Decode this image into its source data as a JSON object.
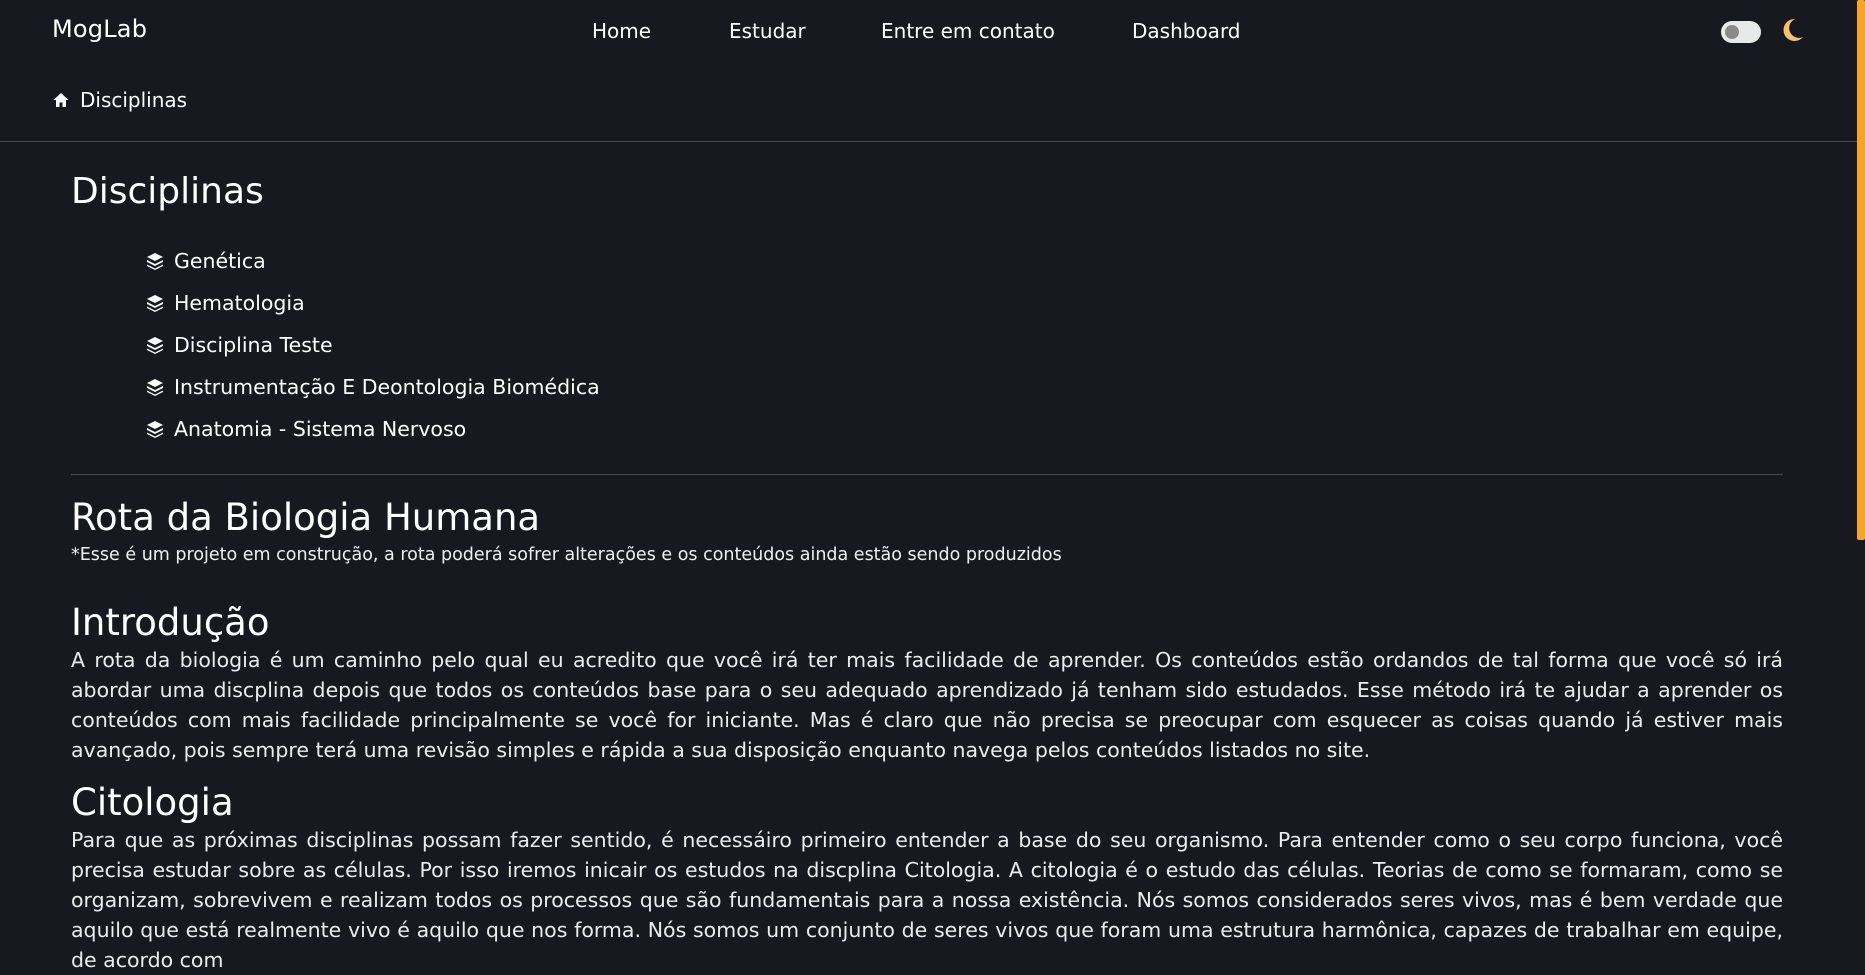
{
  "navbar": {
    "brand": "MogLab",
    "links": [
      "Home",
      "Estudar",
      "Entre em contato",
      "Dashboard"
    ],
    "theme_toggle": "toggle-switch",
    "theme_icon": "moon-icon",
    "accent_color": "#f7c26b"
  },
  "breadcrumb": {
    "icon": "home-icon",
    "label": "Disciplinas"
  },
  "disciplinas": {
    "title": "Disciplinas",
    "item_icon": "books-icon",
    "items": [
      "Genética",
      "Hematologia",
      "Disciplina Teste",
      "Instrumentação E Deontologia Biomédica",
      "Anatomia - Sistema Nervoso"
    ]
  },
  "rota": {
    "title": "Rota da Biologia Humana",
    "note": "*Esse é um projeto em construção, a rota poderá sofrer alterações e os conteúdos ainda estão sendo produzidos"
  },
  "sections": {
    "introducao": {
      "title": "Introdução",
      "text": "A rota da biologia é um caminho pelo qual eu acredito que você irá ter mais facilidade de aprender. Os conteúdos estão ordandos de tal forma que você só irá abordar uma discplina depois que todos os conteúdos base para o seu adequado aprendizado já tenham sido estudados. Esse método irá te ajudar a aprender os conteúdos com mais facilidade principalmente se você for iniciante. Mas é claro que não precisa se preocupar com esquecer as coisas quando já estiver mais avançado, pois sempre terá uma revisão simples e rápida a sua disposição enquanto navega pelos conteúdos listados no site."
    },
    "citologia": {
      "title": "Citologia",
      "text": "Para que as próximas disciplinas possam fazer sentido, é necessáiro primeiro entender a base do seu organismo. Para entender como o seu corpo funciona, você precisa estudar sobre as células. Por isso iremos inicair os estudos na discplina Citologia. A citologia é o estudo das células. Teorias de como se formaram, como se organizam, sobrevivem e realizam todos os processos que são fundamentais para a nossa existência. Nós somos considerados seres vivos, mas é bem verdade que aquilo que está realmente vivo é aquilo que nos forma. Nós somos um conjunto de seres vivos que foram uma estrutura harmônica, capazes de trabalhar em equipe, de acordo com"
    }
  },
  "scrollbar_color": "#f4a62a",
  "background_color": "#181920"
}
